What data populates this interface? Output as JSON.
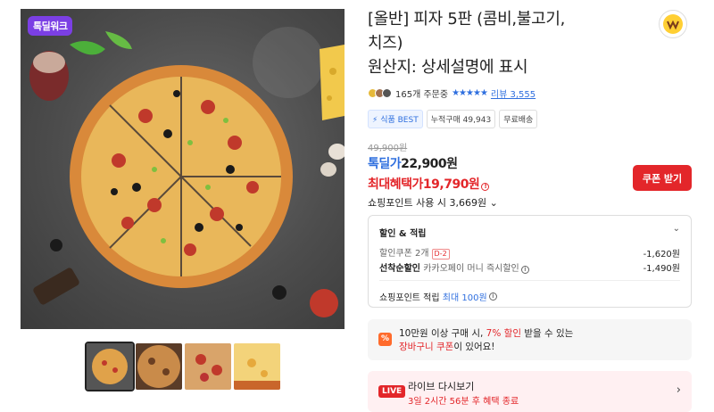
{
  "badge": "톡딜워크",
  "title": "[올반] 피자 5판 (콤비,불고기, 치즈) 원산지: 상세설명에 표시",
  "title_lines": [
    "[올반] 피자 5판 (콤비,불고기,",
    "치즈)",
    "원산지: 상세설명에 표시"
  ],
  "order_count": "165개 주문중",
  "rating_stars": 4.5,
  "review_link": "리뷰 3,555",
  "tags": [
    "식품 BEST",
    "누적구매 49,943",
    "무료배송"
  ],
  "price": {
    "original": "49,900원",
    "deal_label": "톡딜가",
    "deal_value": "22,900원",
    "max_label": "최대혜택가",
    "max_value": "19,790원",
    "points": "쇼핑포인트 사용 시 3,669원"
  },
  "coupon_button": "쿠폰 받기",
  "discount": {
    "title": "할인 & 적립",
    "coupon_label": "할인쿠폰 2개",
    "coupon_dday": "D-2",
    "coupon_value": "-1,620원",
    "early_label": "선착순할인",
    "early_desc": "카카오페이 머니 즉시할인",
    "early_value": "-1,490원",
    "points_label": "쇼핑포인트 적립",
    "points_max_prefix": "최대",
    "points_max_value": "100원"
  },
  "promo": {
    "line1_a": "10만원 이상 구매 시, ",
    "line1_hl": "7% 할인",
    "line1_b": " 받을 수 있는",
    "line2_hl": "장바구니 쿠폰",
    "line2_b": "이 있어요!"
  },
  "live": {
    "badge": "LIVE",
    "title": "라이브 다시보기",
    "sub": "3일 2시간 56분 후 혜택 종료"
  },
  "colors": {
    "accent": "#2f6fdf",
    "sale": "#e3262a",
    "badge": "#7b3fe4"
  }
}
